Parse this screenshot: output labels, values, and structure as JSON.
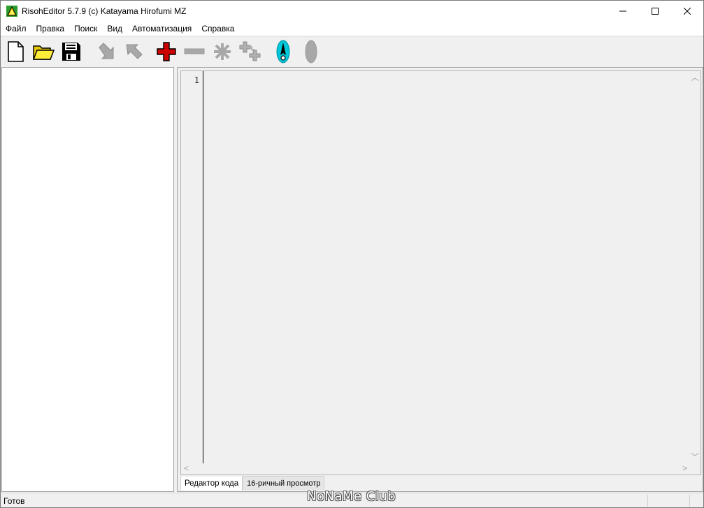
{
  "window": {
    "title": "RisohEditor 5.7.9 (c) Katayama Hirofumi MZ"
  },
  "menu": [
    "Файл",
    "Правка",
    "Поиск",
    "Вид",
    "Автоматизация",
    "Справка"
  ],
  "toolbar": [
    {
      "name": "new-file-icon",
      "enabled": true
    },
    {
      "name": "open-folder-icon",
      "enabled": true
    },
    {
      "name": "save-disk-icon",
      "enabled": true
    },
    {
      "name": "import-arrow-icon",
      "enabled": false
    },
    {
      "name": "export-arrow-icon",
      "enabled": false
    },
    {
      "name": "add-plus-icon",
      "enabled": true
    },
    {
      "name": "remove-minus-icon",
      "enabled": false
    },
    {
      "name": "modify-asterisk-icon",
      "enabled": false
    },
    {
      "name": "copy-plus-icon",
      "enabled": false
    },
    {
      "name": "test-dialog-icon",
      "enabled": true
    },
    {
      "name": "cancel-test-icon",
      "enabled": false
    }
  ],
  "editor": {
    "line_numbers": [
      "1"
    ]
  },
  "tabs": [
    "Редактор кода",
    "16-ричный просмотр"
  ],
  "status": {
    "text": "Готов"
  },
  "watermark": "NoNaMe Club",
  "colors": {
    "accent_red": "#cc0000",
    "disabled_gray": "#a8a8a8",
    "test_cyan": "#00c8d8"
  }
}
